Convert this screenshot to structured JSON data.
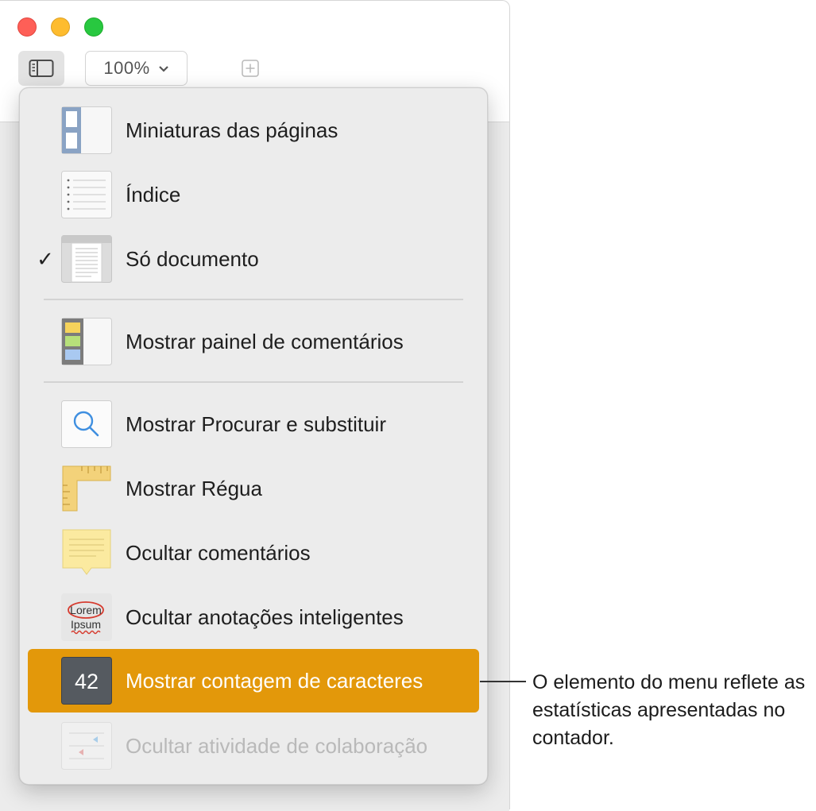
{
  "toolbar": {
    "zoom_value": "100%",
    "icons": {
      "view": "sidebar-view-icon",
      "zoom_chevron": "chevron-down-icon",
      "add": "add-page-icon"
    }
  },
  "menu": {
    "items": [
      {
        "label": "Miniaturas das páginas",
        "icon": "page-thumbnails-icon",
        "checked": false,
        "state": "normal"
      },
      {
        "label": "Índice",
        "icon": "table-of-contents-icon",
        "checked": false,
        "state": "normal"
      },
      {
        "label": "Só documento",
        "icon": "document-only-icon",
        "checked": true,
        "state": "normal"
      },
      {
        "label": "Mostrar painel de comentários",
        "icon": "comments-pane-icon",
        "checked": false,
        "state": "normal"
      },
      {
        "label": "Mostrar Procurar e substituir",
        "icon": "magnifier-icon",
        "checked": false,
        "state": "normal"
      },
      {
        "label": "Mostrar Régua",
        "icon": "ruler-icon",
        "checked": false,
        "state": "normal"
      },
      {
        "label": "Ocultar comentários",
        "icon": "sticky-note-icon",
        "checked": false,
        "state": "normal"
      },
      {
        "label": "Ocultar anotações inteligentes",
        "icon": "smart-annotation-icon",
        "checked": false,
        "state": "normal"
      },
      {
        "label": "Mostrar contagem de caracteres",
        "icon": "character-count-icon",
        "checked": false,
        "state": "highlighted"
      },
      {
        "label": "Ocultar atividade de colaboração",
        "icon": "collaboration-activity-icon",
        "checked": false,
        "state": "disabled"
      }
    ],
    "check_glyph": "✓",
    "count_badge_value": "42",
    "lorem_text_top": "Lorem",
    "lorem_text_bottom": "Ipsum"
  },
  "callout": {
    "text": "O elemento do menu reflete as estatísticas apresentadas no contador."
  },
  "colors": {
    "highlight": "#e3980a",
    "menu_background": "#ececec",
    "close": "#fe5f57",
    "minimize": "#febc2e",
    "zoom": "#28c840"
  }
}
